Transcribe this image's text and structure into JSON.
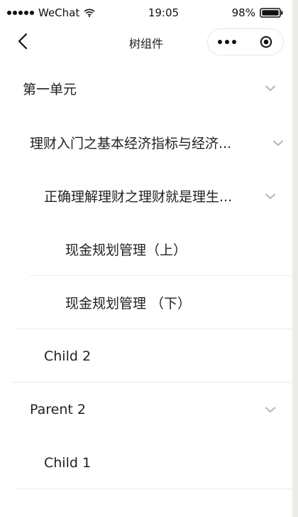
{
  "status_bar": {
    "carrier": "WeChat",
    "time": "19:05",
    "battery": "98%"
  },
  "nav_bar": {
    "title": "树组件"
  },
  "tree": {
    "items": [
      {
        "label": "第一单元"
      },
      {
        "label": "理财入门之基本经济指标与经济..."
      },
      {
        "label": "正确理解理财之理财就是理生..."
      },
      {
        "label": "现金规划管理（上）"
      },
      {
        "label": "现金规划管理 （下）"
      },
      {
        "label": "Child 2"
      },
      {
        "label": "Parent 2"
      },
      {
        "label": "Child 1"
      }
    ]
  }
}
